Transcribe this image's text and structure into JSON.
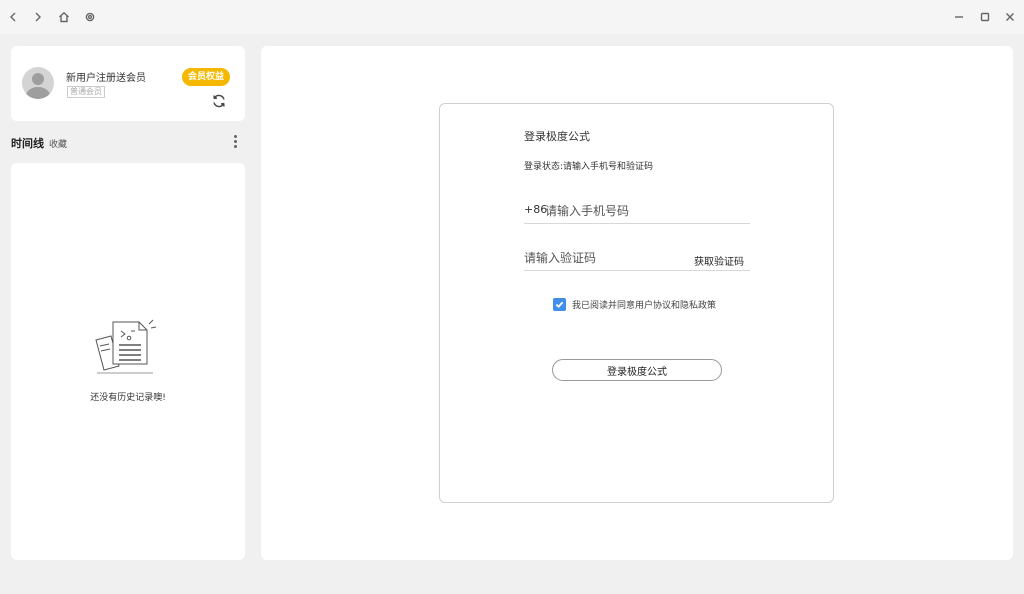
{
  "titlebar": {
    "back_icon": "chevron-left-icon",
    "forward_icon": "chevron-right-icon",
    "home_icon": "home-icon",
    "settings_icon": "gear-icon",
    "minimize_icon": "minimize-icon",
    "maximize_icon": "maximize-icon",
    "close_icon": "close-icon"
  },
  "user": {
    "name": "新用户注册送会员",
    "sub_label": "普通会员",
    "vip_badge": "会员权益",
    "refresh_icon": "refresh-icon"
  },
  "timeline": {
    "title": "时间线",
    "favorites": "收藏",
    "empty_text": "还没有历史记录噢!"
  },
  "login": {
    "title": "登录极度公式",
    "status": "登录状态:请输入手机号和验证码",
    "phone_prefix": "+86",
    "phone_placeholder": "请输入手机号码",
    "code_placeholder": "请输入验证码",
    "get_code": "获取验证码",
    "agreement": "我已阅读并同意用户协议和隐私政策",
    "agreement_checked": true,
    "submit": "登录极度公式"
  },
  "colors": {
    "accent_blue": "#3f8ee8",
    "vip_yellow": "#f5b800"
  }
}
